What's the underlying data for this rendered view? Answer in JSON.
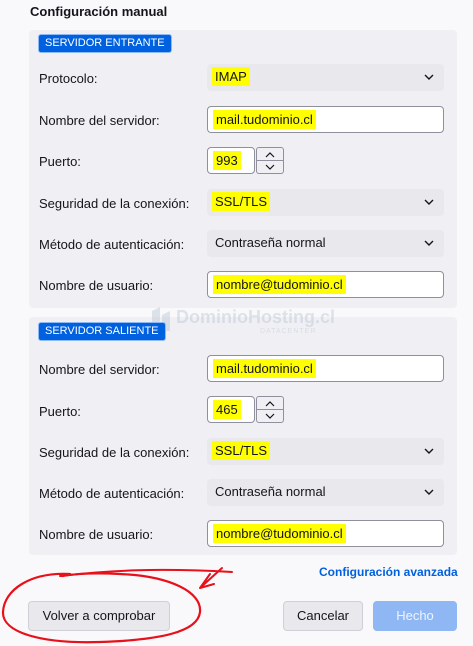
{
  "title": "Configuración manual",
  "incoming": {
    "badge": "SERVIDOR ENTRANTE",
    "protocol_label": "Protocolo:",
    "protocol_value": "IMAP",
    "server_label": "Nombre del servidor:",
    "server_value": "mail.tudominio.cl",
    "port_label": "Puerto:",
    "port_value": "993",
    "security_label": "Seguridad de la conexión:",
    "security_value": "SSL/TLS",
    "auth_label": "Método de autenticación:",
    "auth_value": "Contraseña normal",
    "user_label": "Nombre de usuario:",
    "user_value": "nombre@tudominio.cl"
  },
  "outgoing": {
    "badge": "SERVIDOR SALIENTE",
    "server_label": "Nombre del servidor:",
    "server_value": "mail.tudominio.cl",
    "port_label": "Puerto:",
    "port_value": "465",
    "security_label": "Seguridad de la conexión:",
    "security_value": "SSL/TLS",
    "auth_label": "Método de autenticación:",
    "auth_value": "Contraseña normal",
    "user_label": "Nombre de usuario:",
    "user_value": "nombre@tudominio.cl"
  },
  "watermark": {
    "brand": "DominioHosting.cl",
    "sub": "DATACENTER"
  },
  "advanced_link": "Configuración avanzada",
  "buttons": {
    "retry": "Volver a comprobar",
    "cancel": "Cancelar",
    "done": "Hecho"
  },
  "colors": {
    "accent": "#0061e0",
    "highlight": "#ffff00",
    "annotation": "#e8101a"
  }
}
